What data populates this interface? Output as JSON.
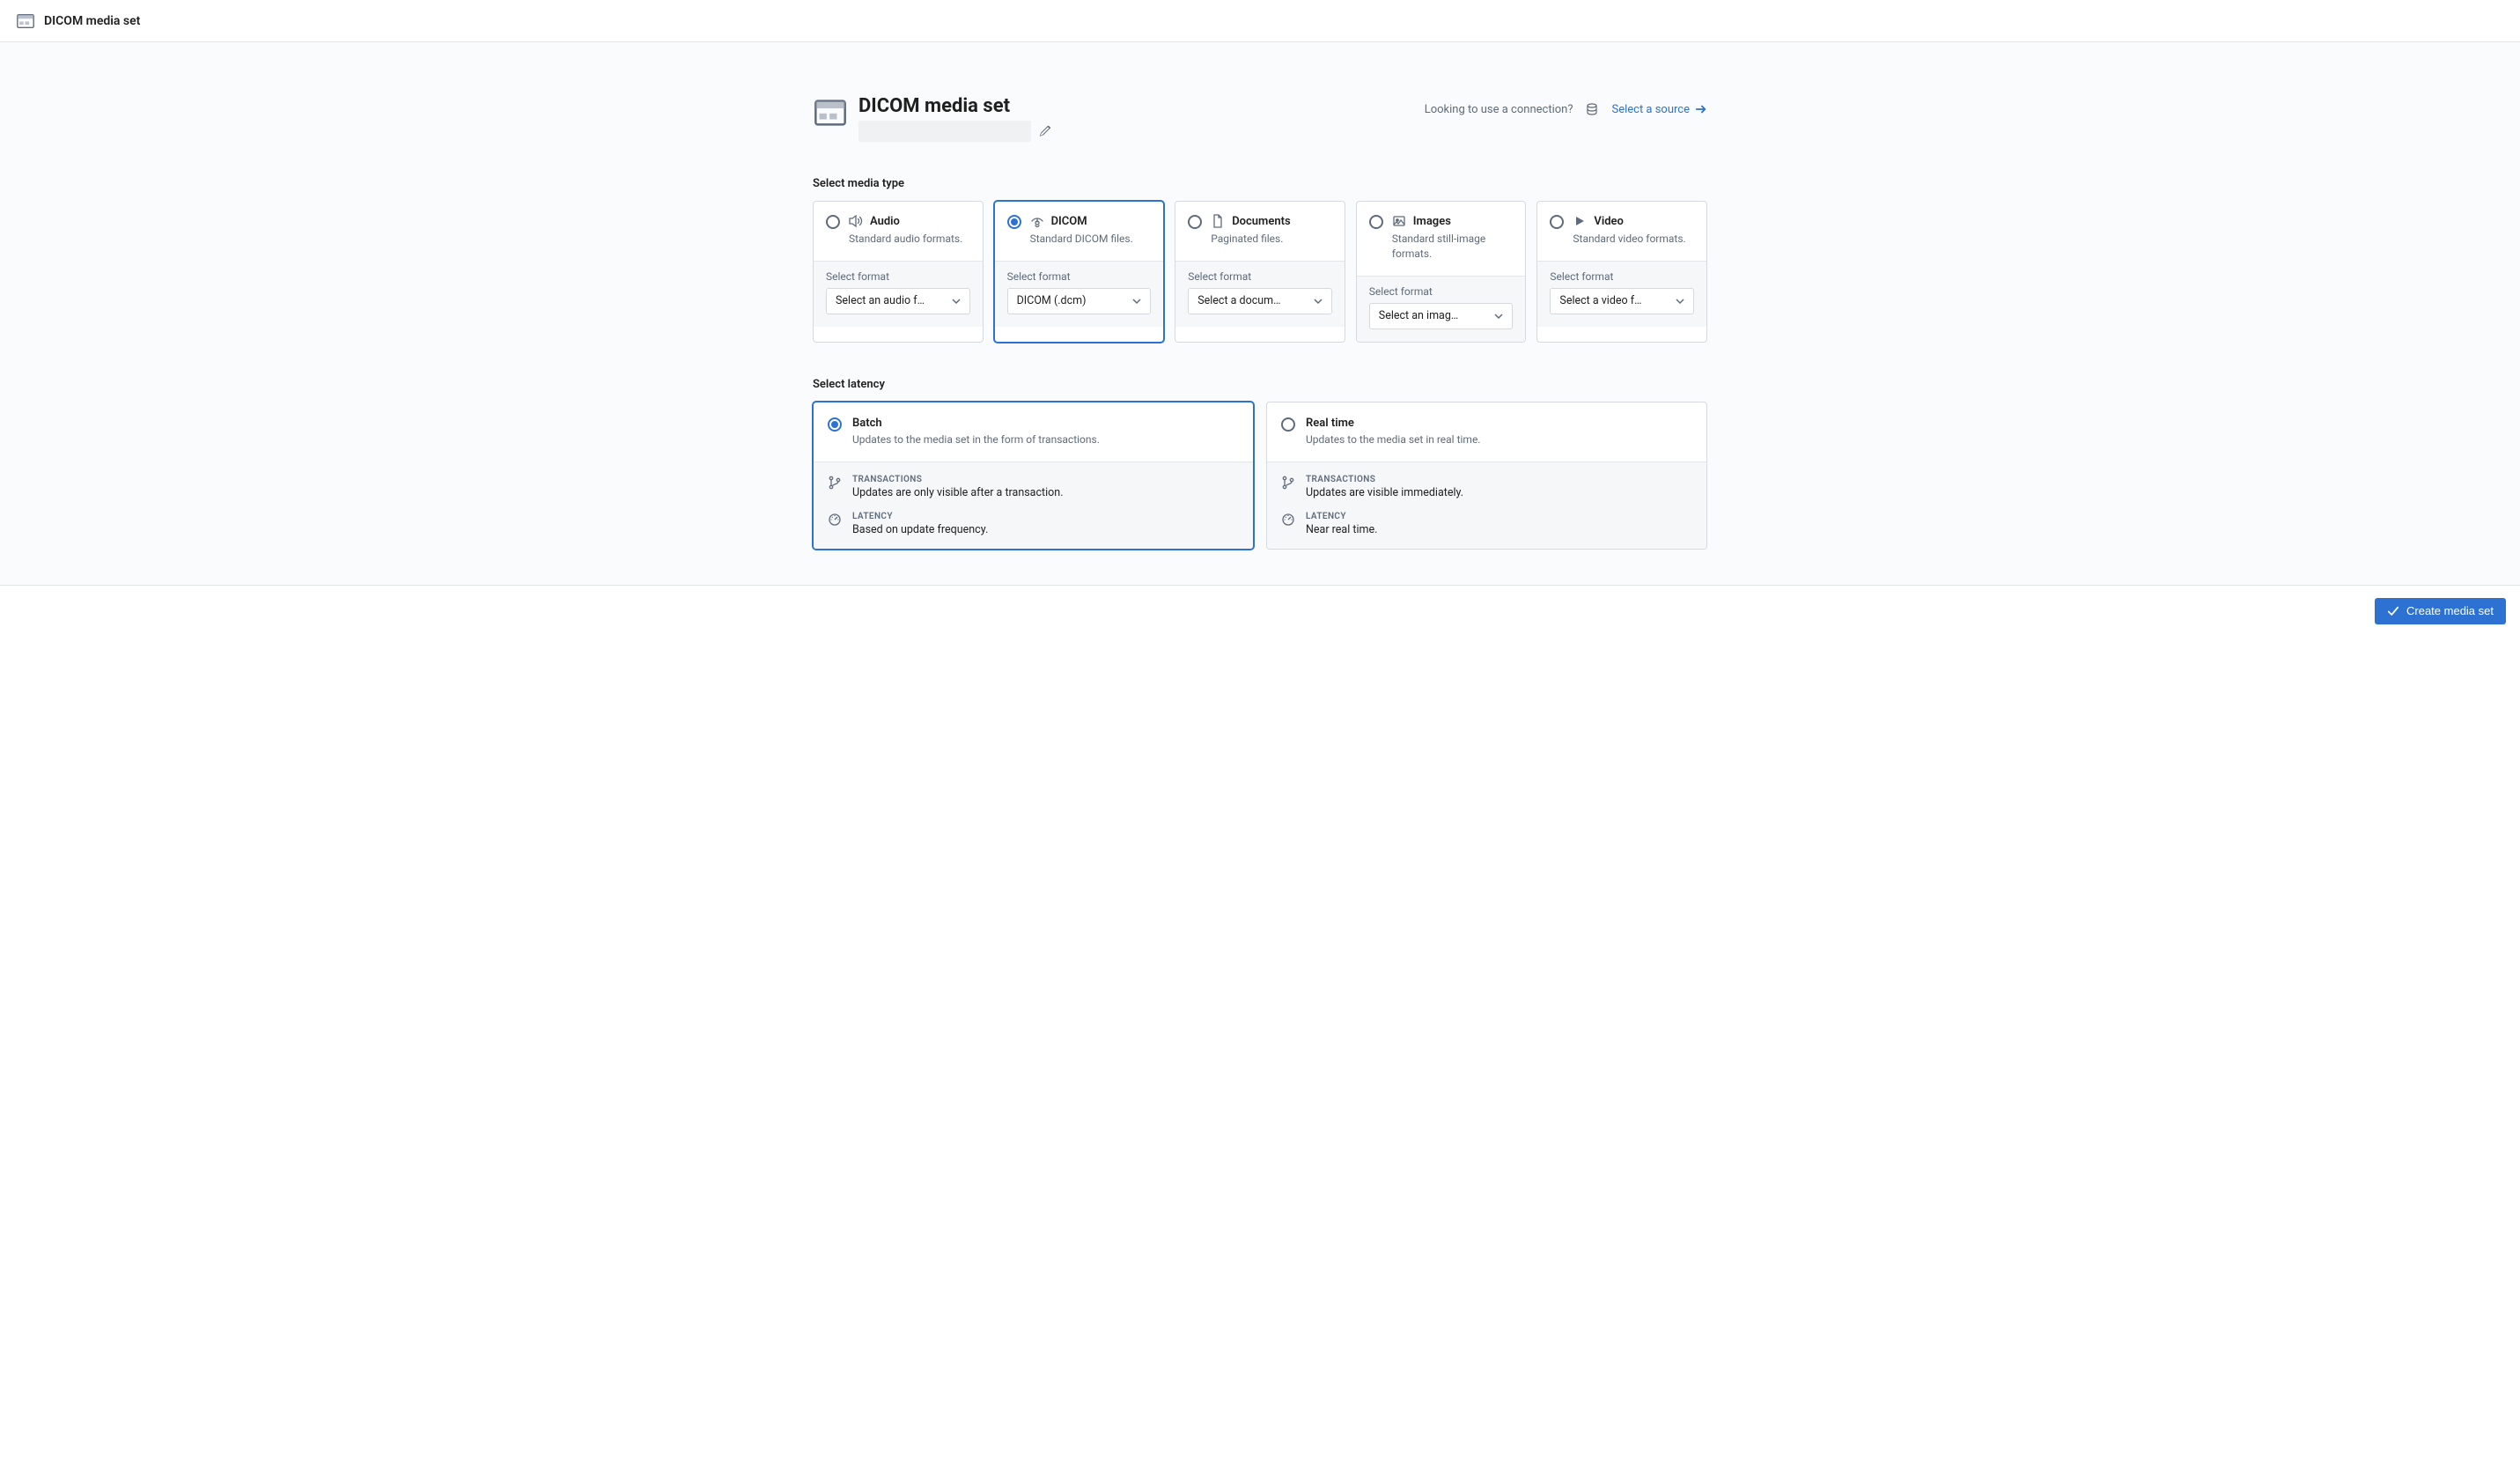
{
  "top_bar": {
    "title": "DICOM media set"
  },
  "header": {
    "title": "DICOM media set",
    "connection_hint": "Looking to use a connection?",
    "select_source_link": "Select a source"
  },
  "media_type": {
    "label": "Select media type",
    "format_label": "Select format",
    "cards": [
      {
        "id": "audio",
        "title": "Audio",
        "desc": "Standard audio formats.",
        "select_value": "Select an audio f…",
        "selected": false
      },
      {
        "id": "dicom",
        "title": "DICOM",
        "desc": "Standard DICOM files.",
        "select_value": "DICOM (.dcm)",
        "selected": true
      },
      {
        "id": "documents",
        "title": "Documents",
        "desc": "Paginated files.",
        "select_value": "Select a docum…",
        "selected": false
      },
      {
        "id": "images",
        "title": "Images",
        "desc": "Standard still-image formats.",
        "select_value": "Select an imag…",
        "selected": false
      },
      {
        "id": "video",
        "title": "Video",
        "desc": "Standard video formats.",
        "select_value": "Select a video f…",
        "selected": false
      }
    ]
  },
  "latency": {
    "label": "Select latency",
    "cards": [
      {
        "id": "batch",
        "title": "Batch",
        "desc": "Updates to the media set in the form of transactions.",
        "selected": true,
        "items": [
          {
            "label": "TRANSACTIONS",
            "text": "Updates are only visible after a transaction."
          },
          {
            "label": "LATENCY",
            "text": "Based on update frequency."
          }
        ]
      },
      {
        "id": "realtime",
        "title": "Real time",
        "desc": "Updates to the media set in real time.",
        "selected": false,
        "items": [
          {
            "label": "TRANSACTIONS",
            "text": "Updates are visible immediately."
          },
          {
            "label": "LATENCY",
            "text": "Near real time."
          }
        ]
      }
    ]
  },
  "footer": {
    "create_label": "Create media set"
  }
}
